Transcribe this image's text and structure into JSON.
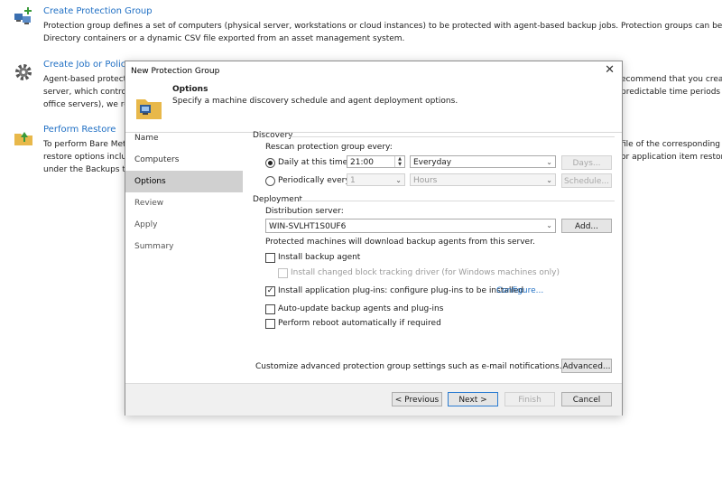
{
  "background": {
    "items": [
      {
        "title": "Create Protection Group",
        "desc_lines": [
          "Protection group defines a set of computers (physical server, workstations or cloud instances) to be protected with agent-based backup jobs. Protection groups can be populate",
          "Directory containers or a dynamic CSV file exported from an asset management system."
        ],
        "icon": "computers-add-icon"
      },
      {
        "title": "Create Job or Policy",
        "desc_lines": [
          "Agent-based protecti",
          "server, which controls",
          "office servers), we rec"
        ],
        "right_lines": [
          "ecommend that you create",
          "predictable time periods (su"
        ],
        "icon": "gear-icon"
      },
      {
        "title": "Perform Restore",
        "desc_lines": [
          "To perform Bare Met",
          "restore options inclu",
          "under the Backups tre"
        ],
        "right_lines": [
          "file of the corresponding",
          "or application item restore"
        ],
        "icon": "restore-folder-icon"
      }
    ]
  },
  "dialog": {
    "title": "New Protection Group",
    "header_title": "Options",
    "header_sub": "Specify a machine discovery schedule and agent deployment options.",
    "steps": [
      "Name",
      "Computers",
      "Options",
      "Review",
      "Apply",
      "Summary"
    ],
    "active_step": 2,
    "discovery": {
      "label": "Discovery",
      "rescan_label": "Rescan protection group every:",
      "daily_label": "Daily at this time:",
      "time_value": "21:00",
      "daily_freq": "Everyday",
      "days_button": "Days...",
      "periodic_label": "Periodically every:",
      "period_value": "1",
      "period_unit": "Hours",
      "schedule_button": "Schedule..."
    },
    "deployment": {
      "label": "Deployment",
      "dist_label": "Distribution server:",
      "dist_value": "WIN-SVLHT1S0UF6",
      "add_button": "Add...",
      "dist_note": "Protected machines will download backup agents from this server.",
      "install_agent": "Install backup agent",
      "install_cbt": "Install changed block tracking driver (for Windows machines only)",
      "install_plugins": "Install application plug-ins: configure plug-ins to be installed",
      "configure_link": "Configure...",
      "auto_update": "Auto-update backup agents and plug-ins",
      "reboot": "Perform reboot automatically if required",
      "checks": {
        "install_agent": false,
        "install_cbt": false,
        "install_plugins": true,
        "auto_update": false,
        "reboot": false
      }
    },
    "advanced_note": "Customize advanced protection group settings such as e-mail notifications.",
    "advanced_button": "Advanced...",
    "buttons": {
      "previous": "< Previous",
      "next": "Next >",
      "finish": "Finish",
      "cancel": "Cancel"
    }
  },
  "colors": {
    "link": "#1f6fc4",
    "active_step": "#d0d0d0",
    "primary_border": "#2a7bd1"
  }
}
